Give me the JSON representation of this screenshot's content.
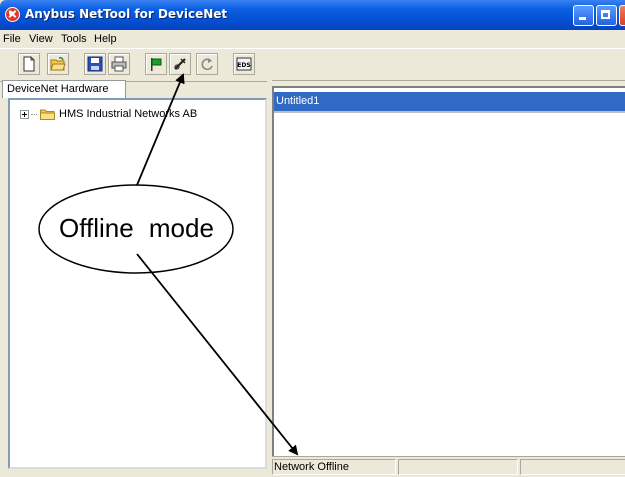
{
  "window": {
    "title": "Anybus NetTool for DeviceNet"
  },
  "menu": {
    "items": [
      "File",
      "View",
      "Tools",
      "Help"
    ]
  },
  "toolbar": {
    "buttons": [
      {
        "icon": "new-document-icon"
      },
      {
        "icon": "open-folder-icon"
      },
      {
        "icon": "save-disk-icon"
      },
      {
        "icon": "print-icon"
      },
      {
        "icon": "green-flag-icon"
      },
      {
        "icon": "go-online-plug-icon"
      },
      {
        "icon": "refresh-icon"
      },
      {
        "icon": "eds-icon",
        "label": "EDS"
      }
    ]
  },
  "left_pane": {
    "tab_label": "DeviceNet Hardware",
    "tree": [
      {
        "label": "HMS Industrial Networks AB",
        "expanded": false
      }
    ]
  },
  "document": {
    "title": "Untitled1"
  },
  "statusbar": {
    "panels": [
      "Network Offline",
      "",
      ""
    ]
  },
  "annotation": {
    "callout_text": "Offline mode"
  },
  "colors": {
    "titlebar": "#0553d6",
    "selection": "#316ac5",
    "chrome": "#ece9d8"
  }
}
